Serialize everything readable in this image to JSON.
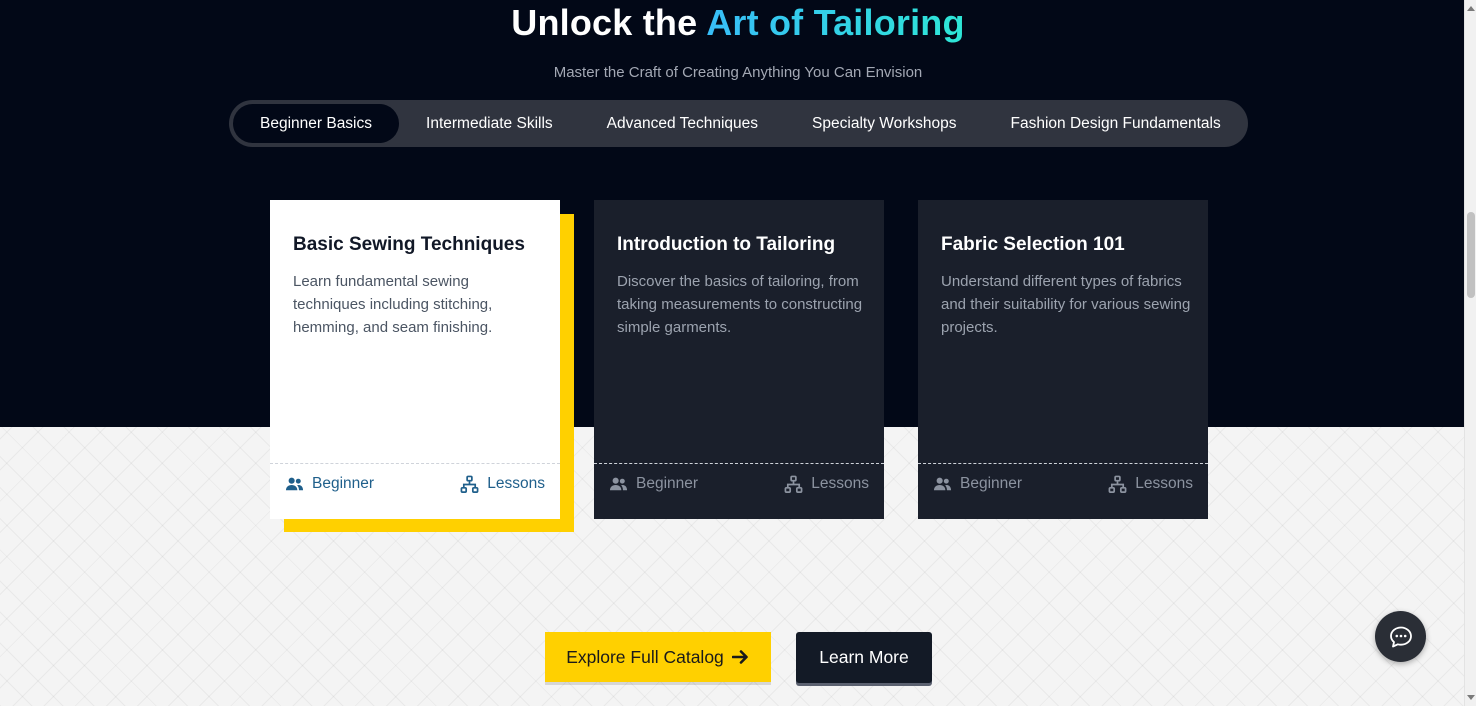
{
  "hero": {
    "title_prefix": "Unlock the ",
    "title_accent": "Art of Tailoring",
    "subtitle": "Master the Craft of Creating Anything You Can Envision",
    "colors": {
      "background": "#020817",
      "accent_start": "#38bdf8",
      "accent_end": "#2ee6d6"
    }
  },
  "tabs": [
    {
      "label": "Beginner Basics",
      "active": true
    },
    {
      "label": "Intermediate Skills",
      "active": false
    },
    {
      "label": "Advanced Techniques",
      "active": false
    },
    {
      "label": "Specialty Workshops",
      "active": false
    },
    {
      "label": "Fashion Design Fundamentals",
      "active": false
    }
  ],
  "cards": [
    {
      "title": "Basic Sewing Techniques",
      "description": "Learn fundamental sewing techniques including stitching, hemming, and seam finishing.",
      "level_icon": "users-icon",
      "level": "Beginner",
      "lessons_icon": "sitemap-icon",
      "lessons": "Lessons",
      "active": true
    },
    {
      "title": "Introduction to Tailoring",
      "description": "Discover the basics of tailoring, from taking measurements to constructing simple garments.",
      "level_icon": "users-icon",
      "level": "Beginner",
      "lessons_icon": "sitemap-icon",
      "lessons": "Lessons",
      "active": false
    },
    {
      "title": "Fabric Selection 101",
      "description": "Understand different types of fabrics and their suitability for various sewing projects.",
      "level_icon": "users-icon",
      "level": "Beginner",
      "lessons_icon": "sitemap-icon",
      "lessons": "Lessons",
      "active": false
    }
  ],
  "actions": {
    "explore_label": "Explore Full Catalog",
    "explore_icon": "arrow-right-icon",
    "learn_more_label": "Learn More",
    "colors": {
      "explore_bg": "#ffd000",
      "learn_more_bg": "#131a26"
    }
  },
  "chat": {
    "icon": "chat-bubble-icon"
  }
}
